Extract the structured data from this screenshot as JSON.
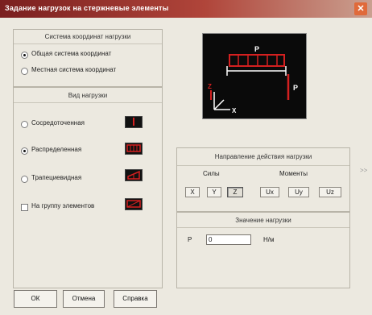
{
  "window": {
    "title": "Задание нагрузок на стержневые элементы",
    "close_glyph": "✕"
  },
  "coords": {
    "header": "Система координат нагрузки",
    "options": [
      "Общая система координат",
      "Местная система координат"
    ],
    "selected": 0
  },
  "load_type": {
    "header": "Вид нагрузки",
    "options": [
      "Сосредоточенная",
      "Распределенная",
      "Трапециевидная"
    ],
    "selected": 1,
    "group_label": "На группу элементов"
  },
  "direction": {
    "header": "Направление действия нагрузки",
    "forces_label": "Силы",
    "moments_label": "Моменты",
    "force_buttons": [
      "X",
      "Y",
      "Z"
    ],
    "moment_buttons": [
      "Ux",
      "Uy",
      "Uz"
    ],
    "selected_force": "Z",
    "more_glyph": ">>"
  },
  "value": {
    "header": "Значение нагрузки",
    "param_label": "P",
    "input_value": "0",
    "unit": "Н/м"
  },
  "preview": {
    "load_label": "P",
    "point_label": "P",
    "axis_x": "X",
    "axis_z": "Z"
  },
  "buttons": {
    "ok": "ОК",
    "cancel": "Отмена",
    "help": "Справка"
  },
  "colors": {
    "load": "#d42020",
    "title_start": "#7a1f1f",
    "title_end": "#caa090"
  }
}
